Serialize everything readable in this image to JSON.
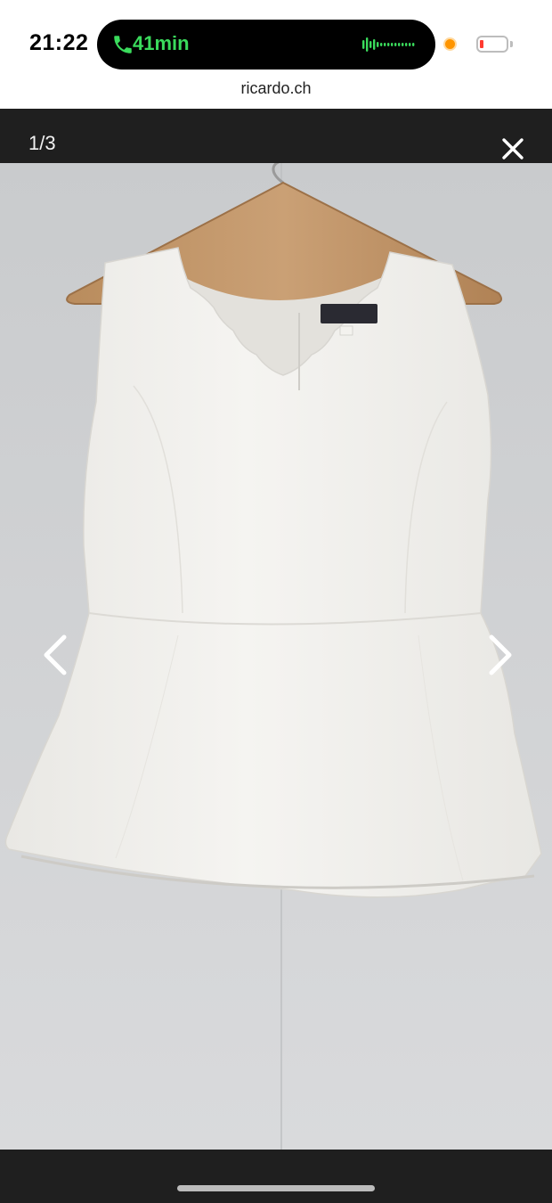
{
  "status_bar": {
    "time": "21:22",
    "call_duration": "41min",
    "call_color": "#3adb5c",
    "icons": [
      "phone-icon",
      "waveform-icon",
      "recording-indicator",
      "battery-icon"
    ]
  },
  "browser": {
    "url": "ricardo.ch"
  },
  "gallery": {
    "counter": "1/3",
    "close_icon": "close-icon",
    "prev_icon": "chevron-left-icon",
    "next_icon": "chevron-right-icon",
    "photo_subject": "white peplum top on hanger",
    "background_color": "#1f1f1f",
    "photo_background": "#d2d3d5"
  }
}
